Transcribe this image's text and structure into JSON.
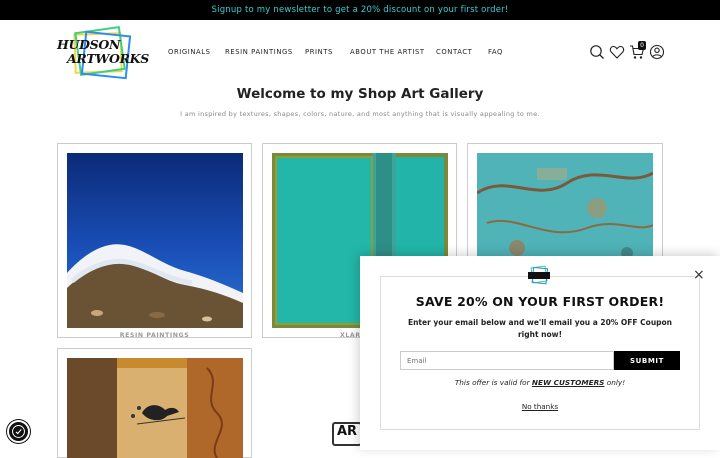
{
  "announcement": "Signup to my newsletter to get a 20% discount on your first order!",
  "logo": {
    "line1": "HUDSON",
    "line2": "ARTWORKS"
  },
  "nav": [
    "ORIGINALS",
    "RESIN PAINTINGS",
    "PRINTS",
    "ABOUT THE ARTIST",
    "CONTACT",
    "FAQ"
  ],
  "header_icons": [
    "search-icon",
    "heart-icon",
    "cart-icon",
    "account-icon"
  ],
  "cart_count": "0",
  "hero": {
    "title": "Welcome to my Shop Art Gallery",
    "subtitle": "I am inspired by textures, shapes, colors, nature, and most anything that is visually appealing to me."
  },
  "cards": [
    {
      "caption": "RESIN PAINTINGS"
    },
    {
      "caption": "XLARGE P"
    },
    {
      "caption": ""
    },
    {
      "caption": ""
    }
  ],
  "badge_text": "AR",
  "popup": {
    "heading": "SAVE 20% ON YOUR FIRST ORDER!",
    "description": "Enter your email below and we'll email you a 20% OFF Coupon right now!",
    "email_placeholder": "Email",
    "submit_label": "SUBMIT",
    "offer_prefix": "This offer is valid for ",
    "offer_emph": "NEW CUSTOMERS",
    "offer_suffix": " only!",
    "no_thanks": "No thanks",
    "close_label": "×"
  },
  "colors": {
    "announcement_bg": "#000000",
    "announcement_text": "#35d0d4",
    "button": "#000000"
  }
}
